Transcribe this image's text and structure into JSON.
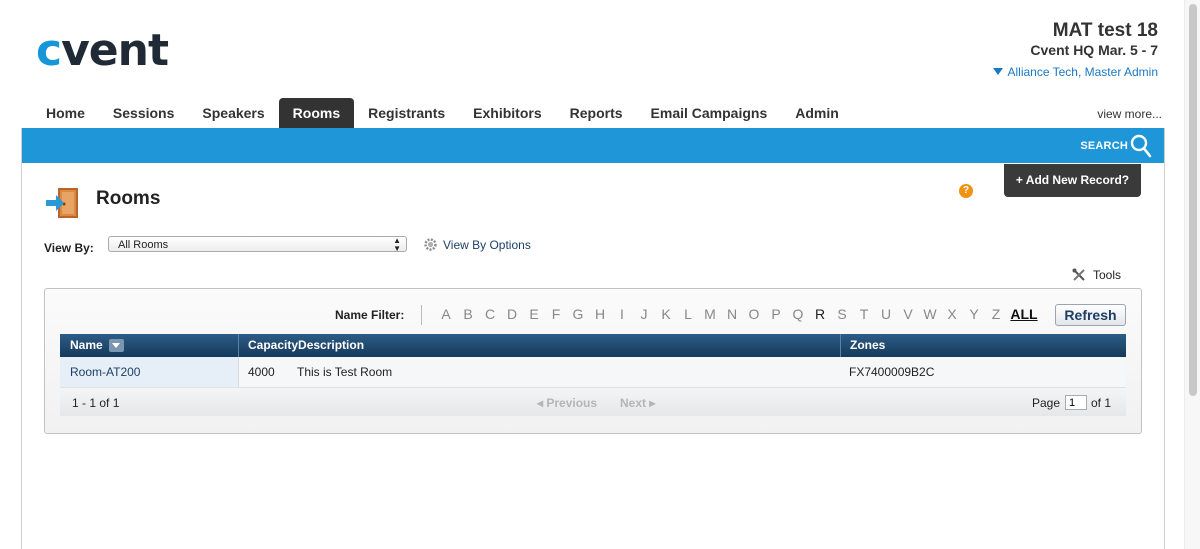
{
  "brand": {
    "logo_c": "c",
    "logo_rest": "vent"
  },
  "event": {
    "title": "MAT test 18",
    "subtitle": "Cvent HQ Mar. 5 - 7",
    "user": "Alliance Tech, Master Admin"
  },
  "tabs": [
    {
      "label": "Home",
      "active": false
    },
    {
      "label": "Sessions",
      "active": false
    },
    {
      "label": "Speakers",
      "active": false
    },
    {
      "label": "Rooms",
      "active": true
    },
    {
      "label": "Registrants",
      "active": false
    },
    {
      "label": "Exhibitors",
      "active": false
    },
    {
      "label": "Reports",
      "active": false
    },
    {
      "label": "Email Campaigns",
      "active": false
    },
    {
      "label": "Admin",
      "active": false
    }
  ],
  "view_more": "view more...",
  "search": {
    "label": "SEARCH",
    "icon": "search-icon"
  },
  "page": {
    "title": "Rooms",
    "icon": "door-icon",
    "help_icon": "?"
  },
  "add_record": "+ Add New Record?",
  "view_by": {
    "label": "View By:",
    "selected": "All Rooms",
    "options_link": "View By Options"
  },
  "tools": "Tools",
  "filter": {
    "label": "Name Filter:",
    "letters": [
      "A",
      "B",
      "C",
      "D",
      "E",
      "F",
      "G",
      "H",
      "I",
      "J",
      "K",
      "L",
      "M",
      "N",
      "O",
      "P",
      "Q",
      "R",
      "S",
      "T",
      "U",
      "V",
      "W",
      "X",
      "Y",
      "Z"
    ],
    "active_letters": [
      "R"
    ],
    "all_label": "ALL"
  },
  "refresh": "Refresh",
  "grid": {
    "columns": {
      "name": "Name",
      "capacity_description": "CapacityDescription",
      "zones": "Zones"
    },
    "rows": [
      {
        "name": "Room-AT200",
        "capacity": "4000",
        "description": "This is Test Room",
        "zones": "FX7400009B2C"
      }
    ],
    "footer": {
      "count": "1 - 1 of 1",
      "previous": "Previous",
      "next": "Next",
      "page_label": "Page",
      "page_value": "1",
      "of_label": "of 1"
    }
  },
  "colors": {
    "accent_blue": "#1e96d8",
    "tab_active": "#333333",
    "header_navy": "#153a5b",
    "help_orange": "#f09214"
  }
}
